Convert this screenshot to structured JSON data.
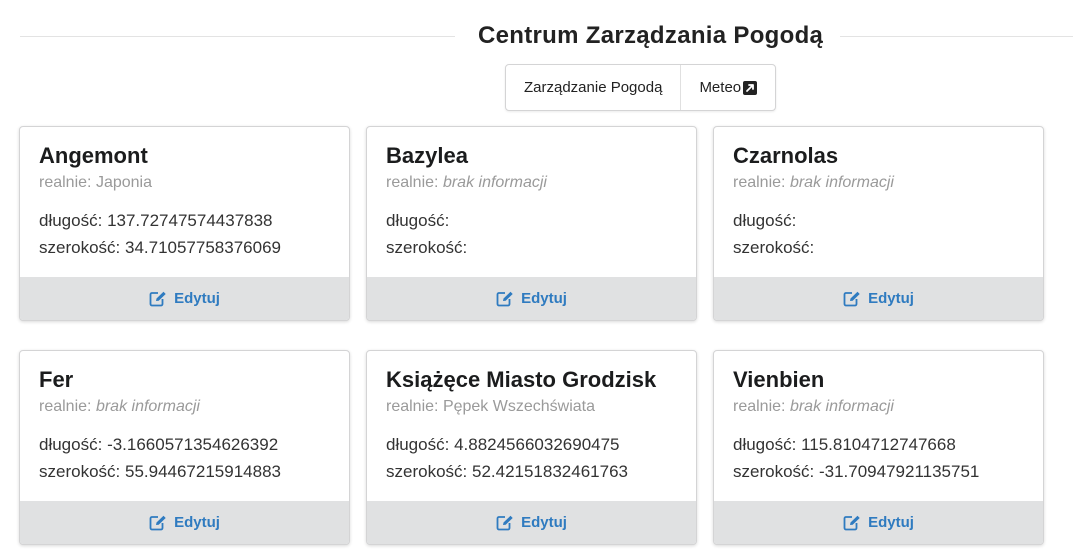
{
  "header": {
    "title": "Centrum Zarządzania Pogodą"
  },
  "menu": {
    "items": [
      {
        "label": "Zarządzanie Pogodą"
      },
      {
        "label": "Meteo",
        "icon": "external-link-icon"
      }
    ]
  },
  "labels": {
    "real_prefix": "realnie:",
    "longitude": "długość:",
    "latitude": "szerokość:",
    "edit": "Edytuj"
  },
  "cards": [
    {
      "name": "Angemont",
      "real": "Japonia",
      "real_missing": false,
      "longitude": "137.72747574437838",
      "latitude": "34.71057758376069"
    },
    {
      "name": "Bazylea",
      "real": "brak informacji",
      "real_missing": true,
      "longitude": "",
      "latitude": ""
    },
    {
      "name": "Czarnolas",
      "real": "brak informacji",
      "real_missing": true,
      "longitude": "",
      "latitude": ""
    },
    {
      "name": "Fer",
      "real": "brak informacji",
      "real_missing": true,
      "longitude": "-3.1660571354626392",
      "latitude": "55.94467215914883"
    },
    {
      "name": "Książęce Miasto Grodzisk",
      "real": "Pępek Wszechświata",
      "real_missing": false,
      "longitude": "4.8824566032690475",
      "latitude": "52.42151832461763"
    },
    {
      "name": "Vienbien",
      "real": "brak informacji",
      "real_missing": true,
      "longitude": "115.8104712747668",
      "latitude": "-31.70947921135751"
    }
  ],
  "colors": {
    "accent": "#2f7bc0",
    "footer_bg": "#e0e1e2",
    "meta_text": "#9a9a9a"
  }
}
